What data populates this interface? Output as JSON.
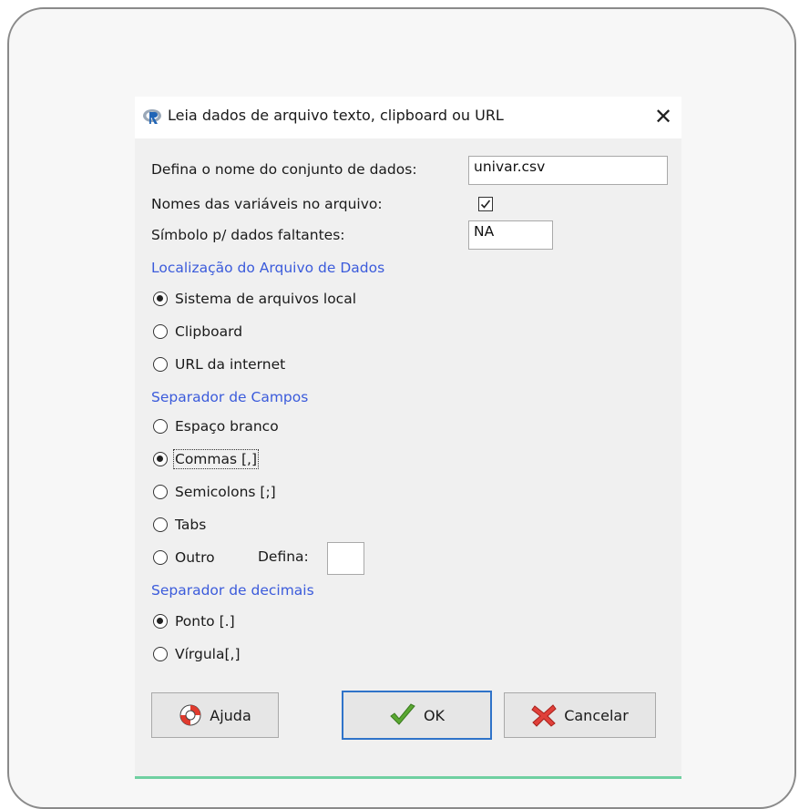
{
  "window": {
    "title": "Leia dados de arquivo texto, clipboard ou URL",
    "close_icon": "close-icon"
  },
  "fields": {
    "dataset_name_label": "Defina o nome do conjunto de dados:",
    "dataset_name_value": "univar.csv",
    "varnames_label": "Nomes das variáveis no arquivo:",
    "varnames_checked": true,
    "missing_label": "Símbolo p/ dados faltantes:",
    "missing_value": "NA"
  },
  "location": {
    "heading": "Localização do Arquivo de Dados",
    "options": [
      {
        "label": "Sistema de arquivos local",
        "selected": true
      },
      {
        "label": "Clipboard",
        "selected": false
      },
      {
        "label": "URL da internet",
        "selected": false
      }
    ]
  },
  "field_sep": {
    "heading": "Separador de Campos",
    "options": [
      {
        "label": "Espaço branco",
        "selected": false
      },
      {
        "label": "Commas [,]",
        "selected": true
      },
      {
        "label": "Semicolons [;]",
        "selected": false
      },
      {
        "label": "Tabs",
        "selected": false
      },
      {
        "label": "Outro",
        "selected": false
      }
    ],
    "other_label": "Defina:",
    "other_value": ""
  },
  "decimal_sep": {
    "heading": "Separador de decimais",
    "options": [
      {
        "label": "Ponto [.]",
        "selected": true
      },
      {
        "label": "Vírgula[,]",
        "selected": false
      }
    ]
  },
  "buttons": {
    "help": "Ajuda",
    "ok": "OK",
    "cancel": "Cancelar"
  },
  "colors": {
    "section_heading": "#3b5bdb",
    "default_button_border": "#2f73c9",
    "accent_line": "#6fd0a1"
  }
}
